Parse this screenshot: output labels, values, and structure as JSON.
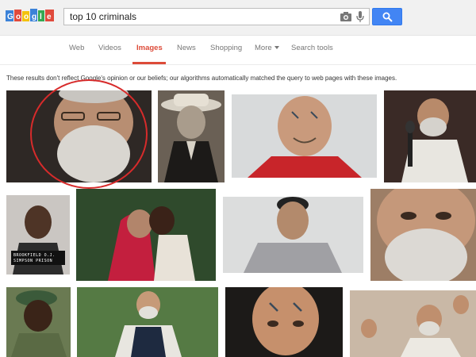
{
  "header": {
    "logo_name": "google-doodle-logo",
    "search_query": "top 10 criminals",
    "camera_icon": "camera-icon",
    "mic_icon": "microphone-icon",
    "search_icon": "search-icon"
  },
  "nav": {
    "tabs": [
      {
        "label": "Web"
      },
      {
        "label": "Videos"
      },
      {
        "label": "Images"
      },
      {
        "label": "News"
      },
      {
        "label": "Shopping"
      },
      {
        "label": "More"
      },
      {
        "label": "Search tools"
      }
    ],
    "active": "Images"
  },
  "notice": "These results don't reflect Google's opinion or our beliefs; our algorithms automatically matched the query to web pages with these images.",
  "colors": {
    "accent_red": "#dd4b39",
    "search_blue": "#4285f4",
    "highlight_circle": "#d72b2b"
  },
  "placard": {
    "line1": "BROOKFIELD O.J.",
    "line2": "SIMPSON  PRISON"
  }
}
